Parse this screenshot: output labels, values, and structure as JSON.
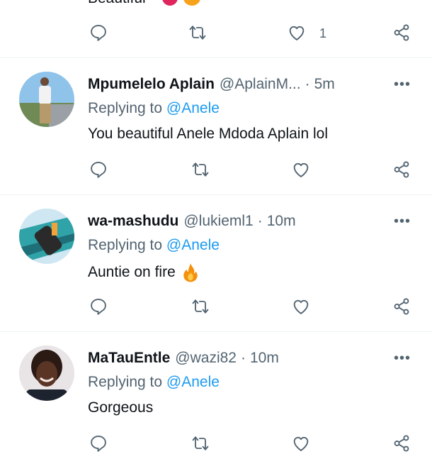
{
  "top_reply": {
    "text_cut": "Beautiful",
    "like_count": "1"
  },
  "tweets": [
    {
      "name": "Mpumelelo Aplain",
      "handle": "@AplainM...",
      "separator": "·",
      "time": "5m",
      "replying_prefix": "Replying to",
      "replying_to": "@Anele",
      "text": "You beautiful Anele Mdoda Aplain lol",
      "emoji": ""
    },
    {
      "name": "wa-mashudu",
      "handle": "@lukieml1",
      "separator": "·",
      "time": "10m",
      "replying_prefix": "Replying to",
      "replying_to": "@Anele",
      "text": "Auntie on fire",
      "emoji": "fire-emoji"
    },
    {
      "name": "MaTauEntle",
      "handle": "@wazi82",
      "separator": "·",
      "time": "10m",
      "replying_prefix": "Replying to",
      "replying_to": "@Anele",
      "text": "Gorgeous",
      "emoji": ""
    }
  ],
  "icons": {
    "reply": "comment-icon",
    "retweet": "retweet-icon",
    "like": "heart-icon",
    "share": "share-icon",
    "more": "more-dots-icon"
  },
  "colors": {
    "text": "#0f1419",
    "secondary": "#536471",
    "link": "#1d9bf0",
    "divider": "#eff3f4"
  }
}
